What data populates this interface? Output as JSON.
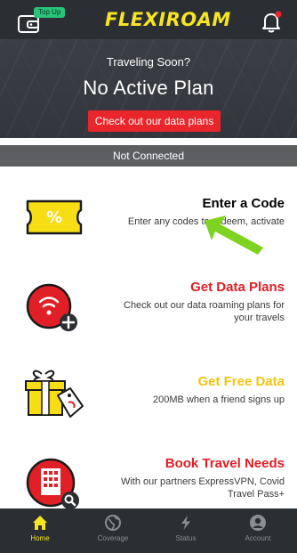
{
  "header": {
    "topup_badge": "Top Up",
    "brand": "FLEXIROAM",
    "hero_subtitle": "Traveling Soon?",
    "hero_title": "No Active Plan",
    "cta_label": "Check out our data plans",
    "connection_status": "Not Connected"
  },
  "features": [
    {
      "title": "Enter a Code",
      "description": "Enter any codes to redeem, activate",
      "icon": "ticket-percent-icon",
      "title_color": "#f3c313"
    },
    {
      "title": "Get Data Plans",
      "description": "Check out our data roaming plans for your travels",
      "icon": "wifi-sim-plus-icon",
      "title_color": "#e11f26"
    },
    {
      "title": "Get Free Data",
      "description": "200MB when a friend signs up",
      "icon": "gift-box-tag-icon",
      "title_color": "#f3c313"
    },
    {
      "title": "Book Travel Needs",
      "description": "With our partners ExpressVPN, Covid Travel Pass+",
      "icon": "building-search-icon",
      "title_color": "#e11f26"
    }
  ],
  "nav": {
    "items": [
      {
        "label": "Home",
        "icon": "home-icon",
        "active": true
      },
      {
        "label": "Coverage",
        "icon": "globe-icon",
        "active": false
      },
      {
        "label": "Status",
        "icon": "lightning-icon",
        "active": false
      },
      {
        "label": "Account",
        "icon": "account-icon",
        "active": false
      }
    ]
  },
  "colors": {
    "brand_yellow": "#f6e51f",
    "accent_red": "#e8262b",
    "header_dark": "#2e3137",
    "badge_green": "#27c57a",
    "annotation_arrow": "#7ed321"
  }
}
